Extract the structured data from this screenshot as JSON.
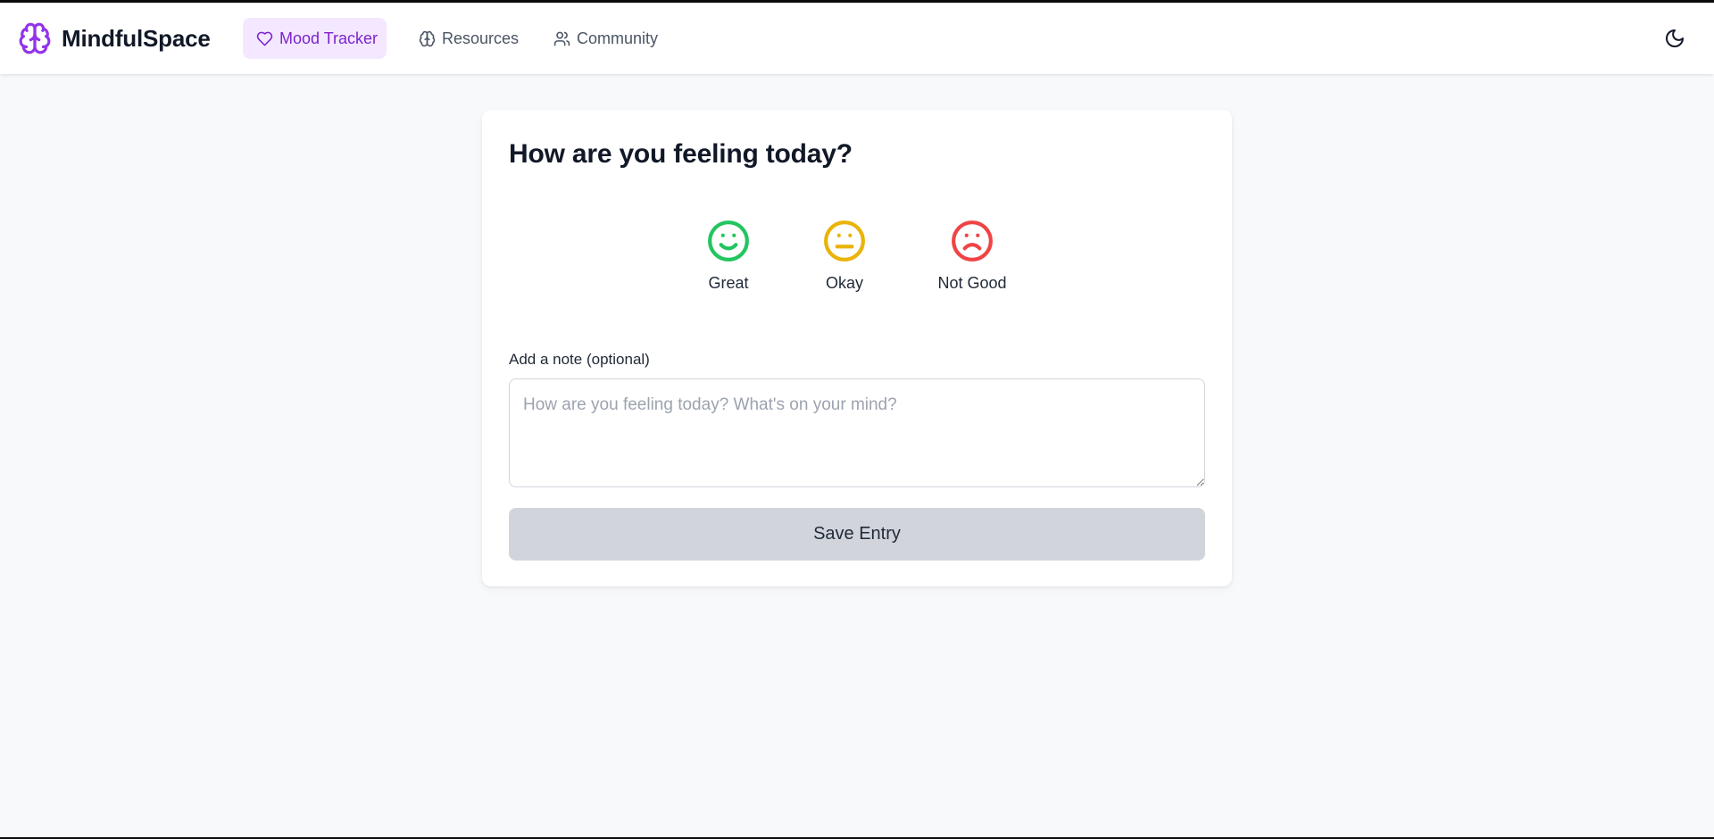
{
  "brand": {
    "name": "MindfulSpace",
    "logo_icon": "brain-icon",
    "accent_color": "#9333ea"
  },
  "nav": {
    "items": [
      {
        "label": "Mood Tracker",
        "icon": "heart-icon",
        "active": true
      },
      {
        "label": "Resources",
        "icon": "brain-icon",
        "active": false
      },
      {
        "label": "Community",
        "icon": "users-icon",
        "active": false
      }
    ],
    "theme_toggle_icon": "moon-icon"
  },
  "mood_card": {
    "title": "How are you feeling today?",
    "moods": [
      {
        "label": "Great",
        "icon": "smile-icon",
        "color": "#22c55e"
      },
      {
        "label": "Okay",
        "icon": "neutral-face-icon",
        "color": "#eab308"
      },
      {
        "label": "Not Good",
        "icon": "frown-icon",
        "color": "#ef4444"
      }
    ],
    "note_label": "Add a note (optional)",
    "note_placeholder": "How are you feeling today? What's on your mind?",
    "note_value": "",
    "save_label": "Save Entry"
  }
}
